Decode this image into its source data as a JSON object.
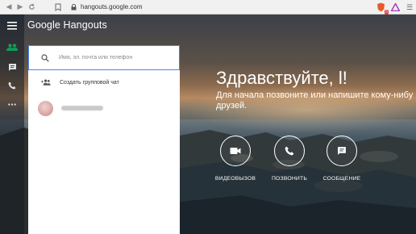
{
  "browser": {
    "url": "hangouts.google.com",
    "extension_badge": "5"
  },
  "app": {
    "title": "Google Hangouts"
  },
  "rail": {
    "icons": [
      "menu-icon",
      "contacts-icon",
      "chat-icon",
      "phone-icon",
      "more-icon"
    ]
  },
  "panel": {
    "search_placeholder": "Имя, эл. почта или телефон",
    "create_group_label": "Создать групповой чат"
  },
  "welcome": {
    "greeting": "Здравствуйте, l!",
    "subtitle_line1": "Для начала позвоните или напишите кому-нибу",
    "subtitle_line2": "друзей."
  },
  "actions": {
    "video_label": "ВИДЕОВЫЗОВ",
    "call_label": "ПОЗВОНИТЬ",
    "message_label": "СООБЩЕНИЕ"
  },
  "colors": {
    "accent": "#4285f4",
    "active_rail": "#0f9d58",
    "panel_bg": "#ffffff"
  }
}
